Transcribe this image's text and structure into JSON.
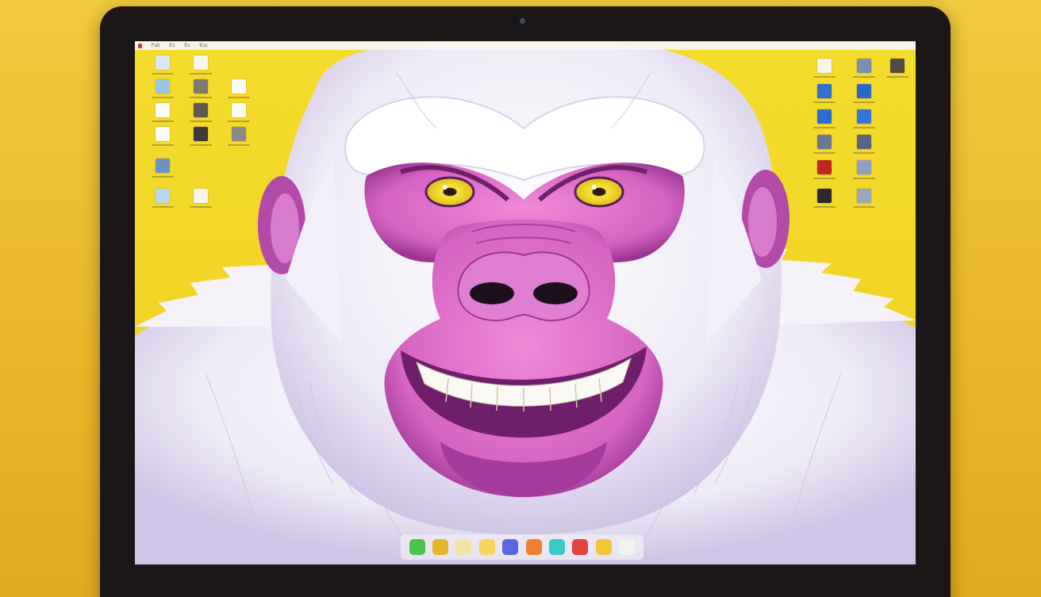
{
  "scene": {
    "description_free": true,
    "backdrop_color": "#ecbf2c",
    "wallpaper_colors": {
      "background": "#f2d72a",
      "fur": "#f7f4f9",
      "fur_shadow": "#cbbfe2",
      "skin": "#d86cc4",
      "skin_dark": "#8d2d86",
      "eyes": "#f2dd2a"
    }
  },
  "menubar": {
    "items": [
      "Fa5",
      "Es",
      "Es",
      "Ess"
    ]
  },
  "desktop_icons": {
    "left": [
      {
        "icon": "document-icon",
        "color": "#d9e9f5"
      },
      {
        "icon": "document-icon",
        "color": "#f7f7f3"
      },
      {
        "icon": "folder-icon",
        "color": "#9cc4e4"
      },
      {
        "icon": "image-icon",
        "color": "#7f7a6f"
      },
      {
        "icon": "document-icon",
        "color": "#fbfbf8"
      },
      {
        "icon": "document-icon",
        "color": "#fbfbf8"
      },
      {
        "icon": "image-icon",
        "color": "#5e5a52"
      },
      {
        "icon": "document-icon",
        "color": "#fbfbf8"
      },
      {
        "icon": "document-icon",
        "color": "#fbfbf8"
      },
      {
        "icon": "image-icon",
        "color": "#3e3a36"
      },
      {
        "icon": "image-icon",
        "color": "#8c8a84"
      },
      {
        "icon": "disk-icon",
        "color": "#6f93c1"
      },
      {
        "icon": "folder-icon",
        "color": "#b9d6ee"
      },
      {
        "icon": "document-icon",
        "color": "#f6f6f1"
      }
    ],
    "right": [
      {
        "icon": "document-icon",
        "color": "#f6f5ef"
      },
      {
        "icon": "image-icon",
        "color": "#7b8eb0"
      },
      {
        "icon": "image-icon",
        "color": "#524c44"
      },
      {
        "icon": "folder-icon",
        "color": "#2f6fd0"
      },
      {
        "icon": "folder-icon",
        "color": "#2d68c8"
      },
      {
        "icon": "folder-icon",
        "color": "#2c6ad4"
      },
      {
        "icon": "folder-icon",
        "color": "#3474d6"
      },
      {
        "icon": "image-icon",
        "color": "#6b7891"
      },
      {
        "icon": "image-icon",
        "color": "#576580"
      },
      {
        "icon": "image-icon",
        "color": "#c0271f"
      },
      {
        "icon": "image-icon",
        "color": "#8da0c0"
      },
      {
        "icon": "image-icon",
        "color": "#2b2b2b"
      },
      {
        "icon": "image-icon",
        "color": "#9aa6bb"
      }
    ]
  },
  "dock": {
    "apps": [
      {
        "icon": "messages-icon",
        "color": "#49c34b"
      },
      {
        "icon": "chrome-icon",
        "color": "#e4b52c"
      },
      {
        "icon": "notes-icon",
        "color": "#f3e3a8"
      },
      {
        "icon": "notes-icon",
        "color": "#f5d65a"
      },
      {
        "icon": "browser-icon",
        "color": "#5b66e0"
      },
      {
        "icon": "photos-icon",
        "color": "#f07f2c"
      },
      {
        "icon": "maps-icon",
        "color": "#3ec7c7"
      },
      {
        "icon": "music-icon",
        "color": "#e2433b"
      },
      {
        "icon": "folder-icon",
        "color": "#f2c53a"
      },
      {
        "icon": "document-icon",
        "color": "#f1f1f1"
      }
    ]
  }
}
